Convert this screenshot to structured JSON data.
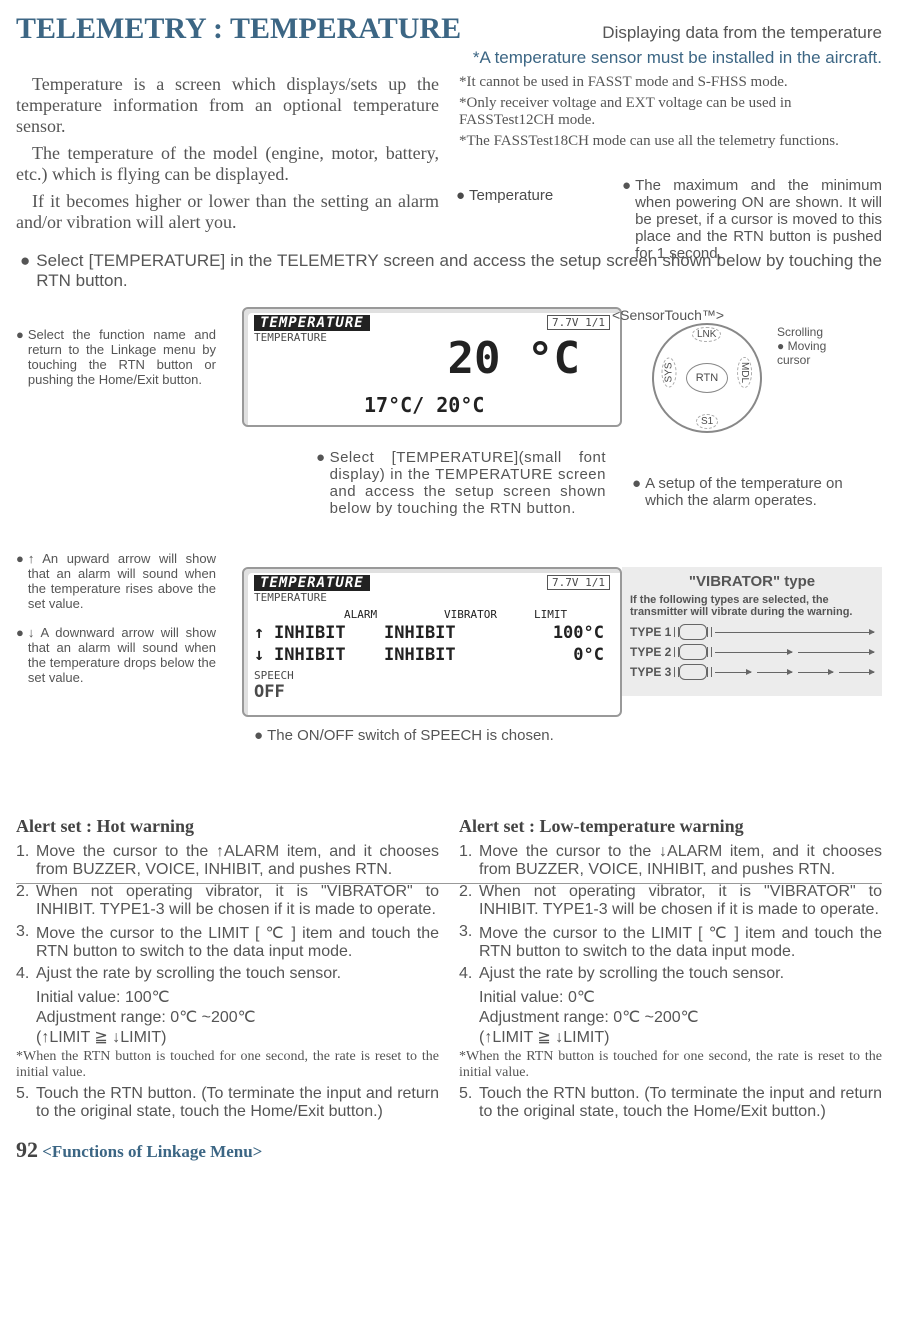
{
  "header": {
    "title": "TELEMETRY : TEMPERATURE",
    "subtitle": "Displaying data from the temperature",
    "sensor_note": "*A temperature sensor must be installed in the aircraft."
  },
  "intro": {
    "p1": "Temperature is a screen which displays/sets up the temperature information from an optional temperature sensor.",
    "p2": "The temperature of the model (engine,  motor, battery, etc.) which is flying can be displayed.",
    "p3": "If it becomes higher or lower than the setting  an alarm and/or vibration will alert you."
  },
  "right_notes": {
    "n1": "*It cannot be used in FASST mode and S-FHSS mode.",
    "n2": "*Only receiver voltage and EXT voltage can be used in FASSTest12CH mode.",
    "n3": "*The FASSTest18CH mode can use all the telemetry functions."
  },
  "step_main": "Select [TEMPERATURE] in the TELEMETRY screen and access the setup screen shown below by touching the RTN button.",
  "label_temperature": "● Temperature",
  "maxmin_note": "The maximum and the minimum when powering ON are shown. It will be preset, if a cursor is moved to this place and the RTN button is pushed for 1 second.",
  "left_notes": {
    "n1": "Select the function name and return to the Linkage menu by touching the RTN button or pushing the Home/Exit button.",
    "n2": "↑ An upward arrow will show that an alarm will sound when the temperature rises above the set value.",
    "n3": "↓ A downward arrow will show that an alarm will sound when the temperature drops below the set value."
  },
  "lcd1": {
    "header": "TEMPERATURE",
    "sub": "TEMPERATURE",
    "corner": "7.7V 1/1",
    "big": "20 °C",
    "range": "17°C/   20°C"
  },
  "middle_note": "Select [TEMPERATURE](small font display) in the TEMPERATURE screen and access the setup screen shown below by touching the RTN button.",
  "alarm_setup_note": "A setup of the temperature on which the alarm operates.",
  "lcd2": {
    "header": "TEMPERATURE",
    "sub": "TEMPERATURE",
    "corner": "7.7V 1/1",
    "cols": {
      "c1": "ALARM",
      "c2": "VIBRATOR",
      "c3": "LIMIT"
    },
    "row1": {
      "arrow": "↑",
      "alarm": "INHIBIT",
      "vib": "INHIBIT",
      "limit": "100°C"
    },
    "row2": {
      "arrow": "↓",
      "alarm": "INHIBIT",
      "vib": "INHIBIT",
      "limit": "0°C"
    },
    "speech_label": "SPEECH",
    "speech_value": "OFF"
  },
  "speech_note": "The ON/OFF switch of SPEECH is chosen.",
  "sensortouch": {
    "title": "<SensorTouch™>",
    "center": "RTN",
    "lnk": "LNK",
    "sys": "SYS",
    "mdl": "MDL",
    "s1": "S1",
    "scrolling": "Scrolling",
    "moving": "● Moving cursor"
  },
  "vibrator_box": {
    "title": "\"VIBRATOR\" type",
    "desc": "If the following types are selected, the transmitter will vibrate during the warning.",
    "t1": "TYPE 1",
    "t2": "TYPE 2",
    "t3": "TYPE 3"
  },
  "hot": {
    "title": "Alert set : Hot warning",
    "s1": "Move the cursor to the ↑ALARM  item, and it chooses from BUZZER, VOICE, INHIBIT, and pushes RTN.",
    "s2": "When not operating vibrator, it is \"VIBRATOR\" to INHIBIT. TYPE1-3 will be chosen if it is made to operate.",
    "s3": "Move the cursor to the LIMIT [  ℃ ] item and touch the RTN button to switch to the data input mode.",
    "s4": "Ajust the rate by scrolling the touch sensor.",
    "s4a": "Initial value: 100℃",
    "s4b": "Adjustment range: 0℃ ~200℃",
    "s4c": "(↑LIMIT ≧ ↓LIMIT)",
    "foot": "*When the RTN button is touched for one second, the rate is reset to the initial value.",
    "s5": "Touch the RTN button. (To terminate the input and return to the original state, touch the Home/Exit button.)"
  },
  "low": {
    "title": "Alert set : Low-temperature warning",
    "s1": "Move the cursor to the  ↓ALARM  item, and it chooses from BUZZER, VOICE, INHIBIT, and pushes RTN.",
    "s2": "When not operating vibrator, it is \"VIBRATOR\" to INHIBIT. TYPE1-3 will be chosen if it is made to operate.",
    "s3": "Move the cursor to the LIMIT [  ℃ ] item and touch the RTN button to switch to the data input mode.",
    "s4": "Ajust the rate by scrolling the touch sensor.",
    "s4a": "Initial value: 0℃",
    "s4b": "Adjustment range: 0℃ ~200℃",
    "s4c": "(↑LIMIT ≧ ↓LIMIT)",
    "foot": "*When the RTN button is touched for one second, the rate is reset to the initial value.",
    "s5": "Touch the RTN button. (To terminate the input and return to the original state, touch the Home/Exit button.)"
  },
  "footer": {
    "page_num": "92",
    "section": "<Functions of Linkage Menu>"
  }
}
